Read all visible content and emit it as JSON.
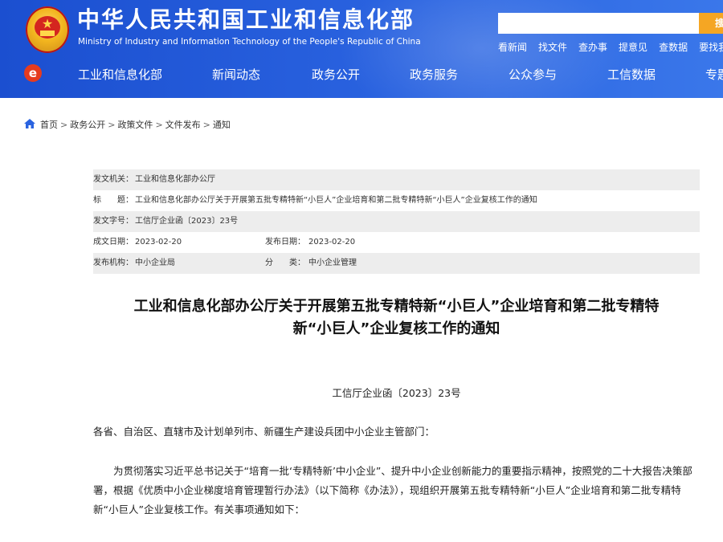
{
  "header": {
    "title": "中华人民共和国工业和信息化部",
    "subtitle": "Ministry of Industry and Information Technology of the People's Republic of China",
    "search": {
      "placeholder": "",
      "button_label": "搜索"
    },
    "quick_links": [
      "看新闻",
      "找文件",
      "查办事",
      "提意见",
      "查数据",
      "要找我"
    ]
  },
  "nav": {
    "items": [
      "工业和信息化部",
      "新闻动态",
      "政务公开",
      "政务服务",
      "公众参与",
      "工信数据",
      "专题"
    ]
  },
  "breadcrumb": [
    "首页",
    "政务公开",
    "政策文件",
    "文件发布",
    "通知"
  ],
  "meta": {
    "issuer_label": "发文机关：",
    "issuer": "工业和信息化部办公厅",
    "title_label": "标　　题：",
    "title": "工业和信息化部办公厅关于开展第五批专精特新“小巨人”企业培育和第二批专精特新“小巨人”企业复核工作的通知",
    "doc_no_label": "发文字号：",
    "doc_no": "工信厅企业函〔2023〕23号",
    "created_label": "成文日期：",
    "created": "2023-02-20",
    "published_label": "发布日期：",
    "published": "2023-02-20",
    "agency_label": "发布机构：",
    "agency": "中小企业局",
    "category_label": "分　　类：",
    "category": "中小企业管理"
  },
  "article": {
    "title_line1": "工业和信息化部办公厅关于开展第五批专精特新“小巨人”企业培育和第二批专精特",
    "title_line2": "新“小巨人”企业复核工作的通知",
    "doc_number": "工信厅企业函〔2023〕23号",
    "salutation": "各省、自治区、直辖市及计划单列市、新疆生产建设兵团中小企业主管部门：",
    "paragraph1": "为贯彻落实习近平总书记关于“培育一批‘专精特新’中小企业”、提升中小企业创新能力的重要指示精神，按照党的二十大报告决策部署，根据《优质中小企业梯度培育管理暂行办法》（以下简称《办法》），现组织开展第五批专精特新“小巨人”企业培育和第二批专精特新“小巨人”企业复核工作。有关事项通知如下："
  },
  "colors": {
    "header_blue": "#2a63e0",
    "search_orange": "#f5a623",
    "meta_shade": "#ededed"
  }
}
